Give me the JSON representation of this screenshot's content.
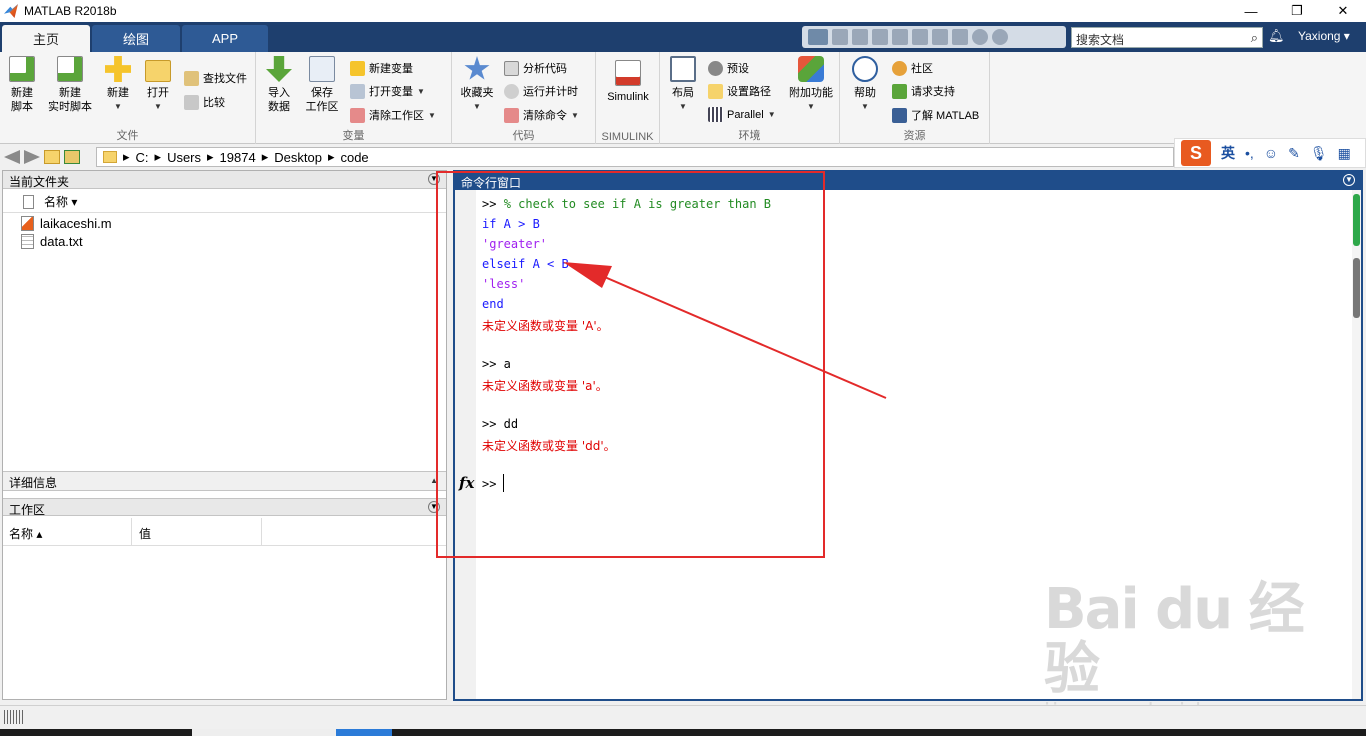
{
  "window": {
    "title": "MATLAB R2018b",
    "controls": {
      "minimize": "—",
      "restore": "❐",
      "close": "✕"
    }
  },
  "tabs": [
    {
      "label": "主页"
    },
    {
      "label": "绘图"
    },
    {
      "label": "APP"
    }
  ],
  "search": {
    "placeholder": "搜索文档"
  },
  "user": {
    "name": "Yaxiong ▾"
  },
  "ribbon": {
    "file": {
      "label": "文件",
      "new_script": "新建\n脚本",
      "new_live_script": "新建\n实时脚本",
      "new": "新建",
      "open": "打开",
      "find_files": "查找文件",
      "compare": "比较"
    },
    "variable": {
      "label": "变量",
      "import_data": "导入\n数据",
      "save_workspace": "保存\n工作区",
      "new_variable": "新建变量",
      "open_variable": "打开变量",
      "clear_workspace": "清除工作区"
    },
    "code": {
      "label": "代码",
      "favorites": "收藏夹",
      "analyze_code": "分析代码",
      "run_and_time": "运行并计时",
      "clear_commands": "清除命令"
    },
    "simulink": {
      "label": "SIMULINK",
      "button": "Simulink"
    },
    "environment": {
      "label": "环境",
      "layout": "布局",
      "preferences": "预设",
      "set_path": "设置路径",
      "parallel": "Parallel",
      "addons": "附加功能"
    },
    "resources": {
      "label": "资源",
      "help": "帮助",
      "community": "社区",
      "request_support": "请求支持",
      "learn_matlab": "了解 MATLAB"
    }
  },
  "address": {
    "segments": [
      "C:",
      "Users",
      "19874",
      "Desktop",
      "code"
    ]
  },
  "ime": {
    "logo": "S",
    "lang": "英",
    "punct": "•,"
  },
  "current_folder": {
    "title": "当前文件夹",
    "column_name": "名称 ▾",
    "files": [
      {
        "name": "laikaceshi.m"
      },
      {
        "name": "data.txt"
      }
    ]
  },
  "details": {
    "title": "详细信息"
  },
  "workspace": {
    "title": "工作区",
    "col_name": "名称 ▴",
    "col_value": "值"
  },
  "command_window": {
    "title": "命令行窗口",
    "lines": [
      {
        "prompt": ">> ",
        "text": "% check to see if A is greater than B",
        "kind": "comment"
      },
      {
        "text": "if A > B",
        "kind": "keyword"
      },
      {
        "text": "'greater'",
        "kind": "string"
      },
      {
        "text": "elseif A < B",
        "kind": "keyword"
      },
      {
        "text": "'less'",
        "kind": "string"
      },
      {
        "text": "end",
        "kind": "keyword"
      },
      {
        "text": "未定义函数或变量 'A'。",
        "kind": "error"
      },
      {
        "text": "",
        "kind": "plain"
      },
      {
        "text": ">> a",
        "kind": "plain"
      },
      {
        "text": "未定义函数或变量 'a'。",
        "kind": "error"
      },
      {
        "text": "",
        "kind": "plain"
      },
      {
        "text": ">> dd",
        "kind": "plain"
      },
      {
        "text": "未定义函数或变量 'dd'。",
        "kind": "error"
      },
      {
        "text": "",
        "kind": "plain"
      },
      {
        "text": ">> ",
        "kind": "plain"
      }
    ],
    "fx": "fx"
  },
  "watermark": {
    "brand": "Bai du 经验",
    "url": "jingyan.baidu.com"
  },
  "colors": {
    "tab_strip": "#1e3f6e",
    "cmd_head": "#1f4d8a",
    "annotation": "#e32a2a",
    "keyword": "#1a1aff",
    "string": "#a020f0",
    "comment": "#228b22",
    "error": "#e00000"
  }
}
